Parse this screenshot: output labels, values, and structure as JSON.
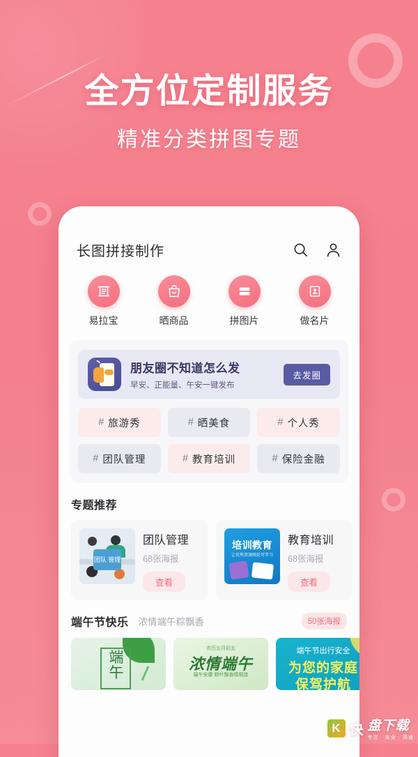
{
  "hero": {
    "headline": "全方位定制服务",
    "subhead": "精准分类拼图专题"
  },
  "app": {
    "title": "长图拼接制作",
    "search_icon": "search-icon",
    "profile_icon": "person-icon"
  },
  "quick_actions": [
    {
      "label": "易拉宝",
      "icon": "banner-stand-icon"
    },
    {
      "label": "晒商品",
      "icon": "shopping-bag-icon"
    },
    {
      "label": "拼图片",
      "icon": "collage-bars-icon"
    },
    {
      "label": "做名片",
      "icon": "id-card-icon"
    }
  ],
  "promo": {
    "icon": "hand-holding-phone-icon",
    "title": "朋友圈不知道怎么发",
    "subtitle": "早安、正能量、午安一键发布",
    "button": "去发圈"
  },
  "tags": [
    {
      "hash": "#",
      "label": "旅游秀",
      "style": "pink"
    },
    {
      "hash": "#",
      "label": "晒美食",
      "style": "gray"
    },
    {
      "hash": "#",
      "label": "个人秀",
      "style": "pink"
    },
    {
      "hash": "#",
      "label": "团队管理",
      "style": "gray"
    },
    {
      "hash": "#",
      "label": "教育培训",
      "style": "pink"
    },
    {
      "hash": "#",
      "label": "保险金融",
      "style": "gray"
    }
  ],
  "topics": {
    "title": "专题推荐",
    "cards": [
      {
        "name": "团队管理",
        "count": "68张海报",
        "button": "查看",
        "thumb_text": "团队\n管理"
      },
      {
        "name": "教育培训",
        "count": "68张海报",
        "button": "查看",
        "thumb_title": "培训教育",
        "thumb_sub": "让优秀资源随处可学习"
      }
    ]
  },
  "festival": {
    "title": "端午节快乐",
    "subtitle": "浓情端午粽飘香",
    "badge": "50张海报",
    "posters": [
      {
        "text": "端午"
      },
      {
        "title": "浓情端午",
        "top_note": "农历五月初五",
        "bottom_note": "端午安康 粽叶飘香情相连"
      },
      {
        "line1": "端午节出行安全",
        "line2": "为您的家庭",
        "line3": "保驾护航"
      }
    ]
  },
  "watermark": {
    "mark": "K",
    "kuai": "快",
    "name": "盘下载",
    "tagline": "专注 · 安全 · 高速"
  }
}
